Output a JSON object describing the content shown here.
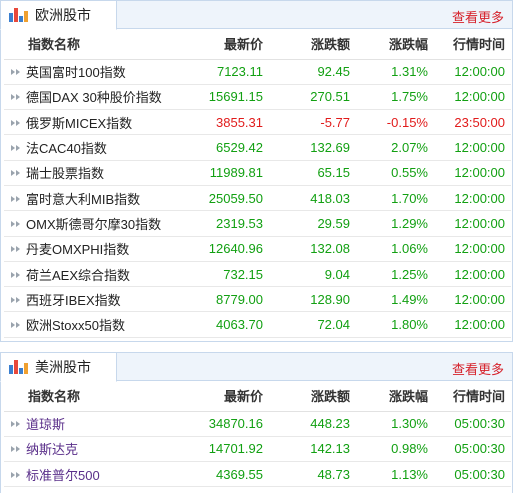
{
  "eu": {
    "title": "欧洲股市",
    "more": "查看更多",
    "headers": [
      "指数名称",
      "最新价",
      "涨跌额",
      "涨跌幅",
      "行情时间"
    ],
    "rows": [
      {
        "name": "英国富时100指数",
        "price": "7123.11",
        "change": "92.45",
        "pct": "1.31%",
        "time": "12:00:00",
        "dir": "up"
      },
      {
        "name": "德国DAX 30种股价指数",
        "price": "15691.15",
        "change": "270.51",
        "pct": "1.75%",
        "time": "12:00:00",
        "dir": "up"
      },
      {
        "name": "俄罗斯MICEX指数",
        "price": "3855.31",
        "change": "-5.77",
        "pct": "-0.15%",
        "time": "23:50:00",
        "dir": "down"
      },
      {
        "name": "法CAC40指数",
        "price": "6529.42",
        "change": "132.69",
        "pct": "2.07%",
        "time": "12:00:00",
        "dir": "up"
      },
      {
        "name": "瑞士股票指数",
        "price": "11989.81",
        "change": "65.15",
        "pct": "0.55%",
        "time": "12:00:00",
        "dir": "up"
      },
      {
        "name": "富时意大利MIB指数",
        "price": "25059.50",
        "change": "418.03",
        "pct": "1.70%",
        "time": "12:00:00",
        "dir": "up"
      },
      {
        "name": "OMX斯德哥尔摩30指数",
        "price": "2319.53",
        "change": "29.59",
        "pct": "1.29%",
        "time": "12:00:00",
        "dir": "up"
      },
      {
        "name": "丹麦OMXPHI指数",
        "price": "12640.96",
        "change": "132.08",
        "pct": "1.06%",
        "time": "12:00:00",
        "dir": "up"
      },
      {
        "name": "荷兰AEX综合指数",
        "price": "732.15",
        "change": "9.04",
        "pct": "1.25%",
        "time": "12:00:00",
        "dir": "up"
      },
      {
        "name": "西班牙IBEX指数",
        "price": "8779.00",
        "change": "128.90",
        "pct": "1.49%",
        "time": "12:00:00",
        "dir": "up"
      },
      {
        "name": "欧洲Stoxx50指数",
        "price": "4063.70",
        "change": "72.04",
        "pct": "1.80%",
        "time": "12:00:00",
        "dir": "up"
      }
    ]
  },
  "us": {
    "title": "美洲股市",
    "more": "查看更多",
    "headers": [
      "指数名称",
      "最新价",
      "涨跌额",
      "涨跌幅",
      "行情时间"
    ],
    "rows": [
      {
        "name": "道琼斯",
        "price": "34870.16",
        "change": "448.23",
        "pct": "1.30%",
        "time": "05:00:30",
        "dir": "up"
      },
      {
        "name": "纳斯达克",
        "price": "14701.92",
        "change": "142.13",
        "pct": "0.98%",
        "time": "05:00:30",
        "dir": "up"
      },
      {
        "name": "标准普尔500",
        "price": "4369.55",
        "change": "48.73",
        "pct": "1.13%",
        "time": "05:00:30",
        "dir": "up"
      }
    ]
  },
  "colors": {
    "up": "#12a012",
    "down": "#e11b1b",
    "more": "#d6202a",
    "header_bg": "#eef4fb",
    "border": "#c7d8ec"
  },
  "icons": {
    "panel": "bar-chart-icon",
    "row": "double-chevron-right-icon"
  }
}
